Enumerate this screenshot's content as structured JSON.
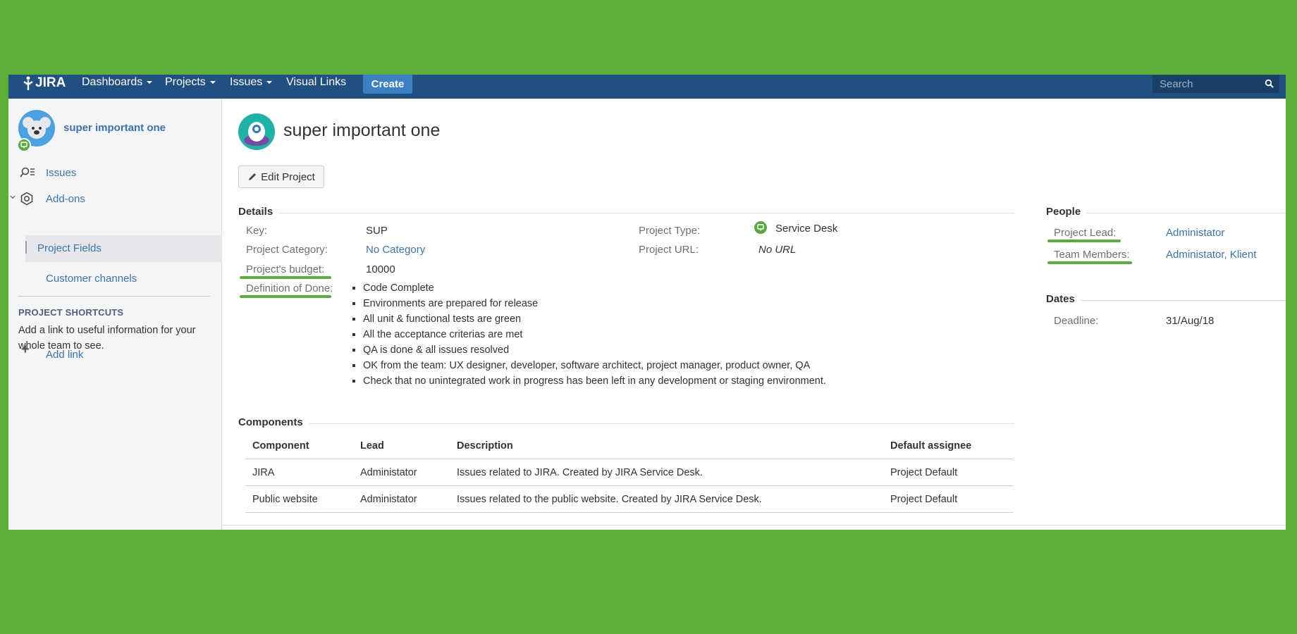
{
  "topnav": {
    "logo": "JIRA",
    "items": [
      "Dashboards",
      "Projects",
      "Issues",
      "Visual Links"
    ],
    "create_label": "Create",
    "search_placeholder": "Search"
  },
  "sidebar": {
    "project_name": "super important one",
    "nav": {
      "issues": "Issues",
      "addons": "Add-ons",
      "project_fields": "Project Fields",
      "customer_channels": "Customer channels"
    },
    "shortcuts_heading": "PROJECT SHORTCUTS",
    "shortcuts_text": "Add a link to useful information for your whole team to see.",
    "add_link": "Add link"
  },
  "main": {
    "title": "super important one",
    "edit_button": "Edit Project",
    "details": {
      "heading": "Details",
      "key_label": "Key:",
      "key_value": "SUP",
      "category_label": "Project Category:",
      "category_value": "No Category",
      "budget_label": "Project's budget:",
      "budget_value": "10000",
      "dod_label": "Definition of Done:",
      "dod_items": [
        "Code Complete",
        "Environments are prepared for release",
        "All unit & functional tests are green",
        "All the acceptance criterias are met",
        "QA is done & all issues resolved",
        "OK from the team: UX designer, developer, software architect, project manager, product owner, QA",
        "Check that no unintegrated work in progress has been left in any development or staging environment."
      ],
      "type_label": "Project Type:",
      "type_value": "Service Desk",
      "url_label": "Project URL:",
      "url_value": "No URL"
    },
    "people": {
      "heading": "People",
      "lead_label": "Project Lead:",
      "lead_value": "Administator",
      "members_label": "Team Members:",
      "members_value": "Administator, Klient"
    },
    "dates": {
      "heading": "Dates",
      "deadline_label": "Deadline:",
      "deadline_value": "31/Aug/18"
    },
    "components": {
      "heading": "Components",
      "columns": [
        "Component",
        "Lead",
        "Description",
        "Default assignee"
      ],
      "rows": [
        [
          "JIRA",
          "Administator",
          "Issues related to JIRA. Created by JIRA Service Desk.",
          "Project Default"
        ],
        [
          "Public website",
          "Administator",
          "Issues related to the public website. Created by JIRA Service Desk.",
          "Project Default"
        ]
      ]
    }
  },
  "colors": {
    "background": "#5baf38",
    "nav": "#205081",
    "link": "#3b73af",
    "highlight": "#5baf38"
  }
}
